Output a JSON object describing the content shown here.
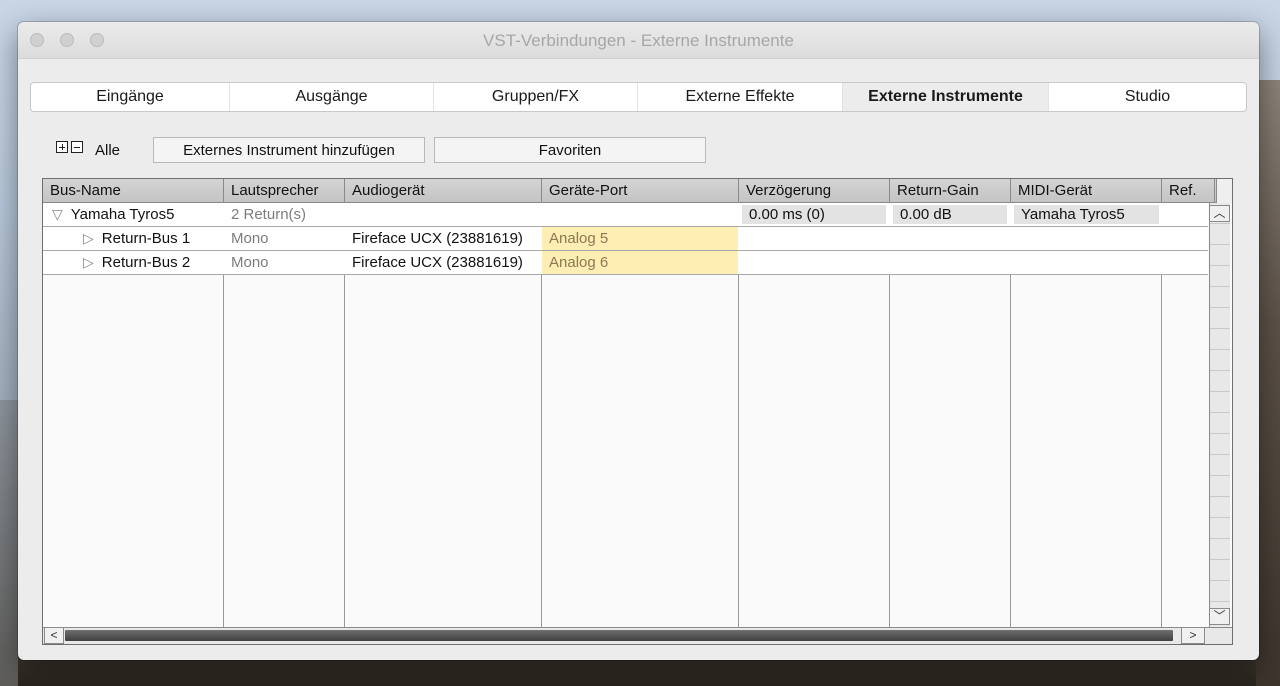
{
  "window": {
    "title": "VST-Verbindungen - Externe Instrumente"
  },
  "tabs": [
    {
      "label": "Eingänge",
      "active": false
    },
    {
      "label": "Ausgänge",
      "active": false
    },
    {
      "label": "Gruppen/FX",
      "active": false
    },
    {
      "label": "Externe Effekte",
      "active": false
    },
    {
      "label": "Externe Instrumente",
      "active": true
    },
    {
      "label": "Studio",
      "active": false
    }
  ],
  "toolbar": {
    "expand_icon": "plus-box-icon",
    "collapse_icon": "minus-box-icon",
    "alle_label": "Alle",
    "add_button_label": "Externes Instrument hinzufügen",
    "favorites_button_label": "Favoriten"
  },
  "table": {
    "columns": [
      "Bus-Name",
      "Lautsprecher",
      "Audiogerät",
      "Geräte-Port",
      "Verzögerung",
      "Return-Gain",
      "MIDI-Gerät",
      "Ref."
    ],
    "rows": [
      {
        "bus_name": "Yamaha Tyros5",
        "expanded": true,
        "speaker": "2 Return(s)",
        "audio_device": "",
        "port": "",
        "delay": "0.00 ms (0)",
        "return_gain": "0.00 dB",
        "midi_device": "Yamaha Tyros5",
        "ref": ""
      },
      {
        "bus_name": "Return-Bus 1",
        "expanded": false,
        "speaker": "Mono",
        "audio_device": "Fireface UCX (23881619)",
        "port": "Analog 5",
        "delay": "",
        "return_gain": "",
        "midi_device": "",
        "ref": ""
      },
      {
        "bus_name": "Return-Bus 2",
        "expanded": false,
        "speaker": "Mono",
        "audio_device": "Fireface UCX (23881619)",
        "port": "Analog 6",
        "delay": "",
        "return_gain": "",
        "midi_device": "",
        "ref": ""
      }
    ]
  },
  "icons": {
    "expanded": "triangle-down-icon",
    "collapsed": "triangle-right-icon",
    "scroll_up": "chevron-up-icon",
    "scroll_down": "chevron-down-icon",
    "scroll_left": "chevron-left-icon",
    "scroll_right": "chevron-right-icon"
  },
  "colors": {
    "port_highlight": "#fdeeb3",
    "active_tab": "#ececec"
  }
}
